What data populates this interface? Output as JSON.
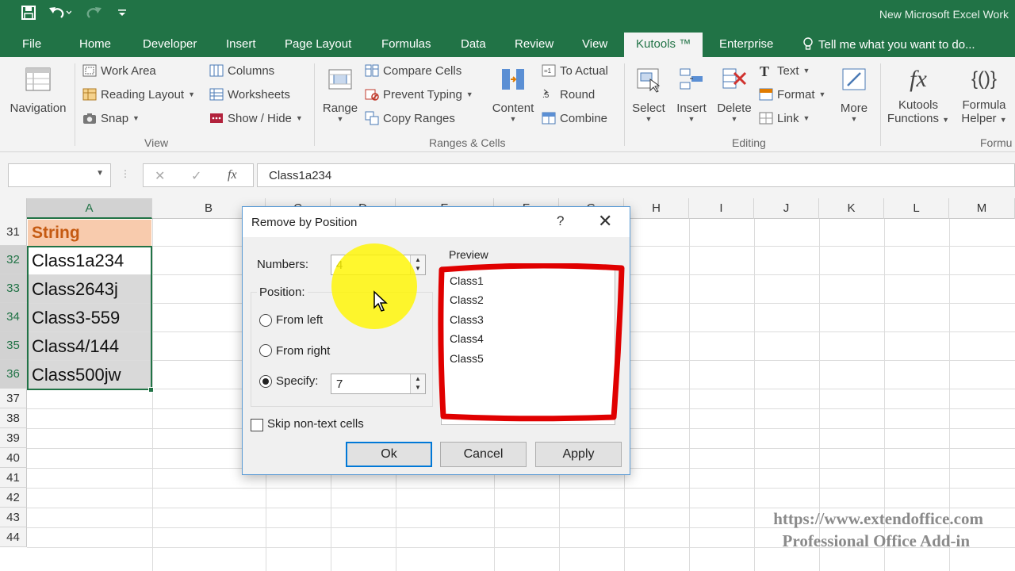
{
  "window": {
    "title": "New Microsoft Excel Work"
  },
  "tabs": [
    "File",
    "Home",
    "Developer",
    "Insert",
    "Page Layout",
    "Formulas",
    "Data",
    "Review",
    "View",
    "Kutools ™",
    "Enterprise",
    "Tell me what you want to do..."
  ],
  "active_tab": "Kutools ™",
  "ribbon": {
    "navigation_label": "Navigation",
    "view_group": {
      "label": "View",
      "items": [
        "Work Area",
        "Reading Layout",
        "Snap",
        "Columns",
        "Worksheets",
        "Show / Hide"
      ]
    },
    "ranges_group": {
      "label": "Ranges & Cells",
      "range_label": "Range",
      "items": [
        "Compare Cells",
        "Prevent Typing",
        "Copy Ranges"
      ],
      "content_label": "Content",
      "items2": [
        "To Actual",
        "Round",
        "Combine"
      ]
    },
    "editing_group": {
      "label": "Editing",
      "big": [
        "Select",
        "Insert",
        "Delete",
        "More"
      ],
      "items": [
        "Text",
        "Format",
        "Link"
      ]
    },
    "kutools_functions": "Kutools Functions",
    "formula_helper": "Formula Helper",
    "formula_group_label": "Formu"
  },
  "formula_bar": {
    "name_box": "",
    "cancel_glyph": "✕",
    "enter_glyph": "✓",
    "fx_glyph": "fx",
    "value": "Class1a234"
  },
  "sheet": {
    "columns": [
      "A",
      "B",
      "C",
      "D",
      "E",
      "F",
      "G",
      "H",
      "I",
      "J",
      "K",
      "L",
      "M"
    ],
    "rows": [
      "31",
      "32",
      "33",
      "34",
      "35",
      "36",
      "37",
      "38",
      "39",
      "40",
      "41",
      "42",
      "43",
      "44"
    ],
    "cells_A": [
      "String",
      "Class1a234",
      "Class2643j",
      "Class3-559",
      "Class4/144",
      "Class500jw"
    ]
  },
  "dialog": {
    "title": "Remove by Position",
    "help": "?",
    "close": "✕",
    "numbers_label": "Numbers:",
    "numbers_value": "4",
    "position_label": "Position:",
    "from_left": "From left",
    "from_right": "From right",
    "specify": "Specify:",
    "specify_value": "7",
    "selected_position": "Specify",
    "skip_label": "Skip non-text cells",
    "skip_checked": false,
    "preview_label": "Preview",
    "preview_items": [
      "Class1",
      "Class2",
      "Class3",
      "Class4",
      "Class5"
    ],
    "ok": "Ok",
    "cancel": "Cancel",
    "apply": "Apply"
  },
  "watermark": {
    "line1": "https://www.extendoffice.com",
    "line2": "Professional Office Add-in"
  },
  "colors": {
    "excel_green": "#217346",
    "header_fill": "#f8cbad",
    "header_text": "#c55a11",
    "annotation_red": "#e00000",
    "highlight_yellow": "#fff500"
  }
}
